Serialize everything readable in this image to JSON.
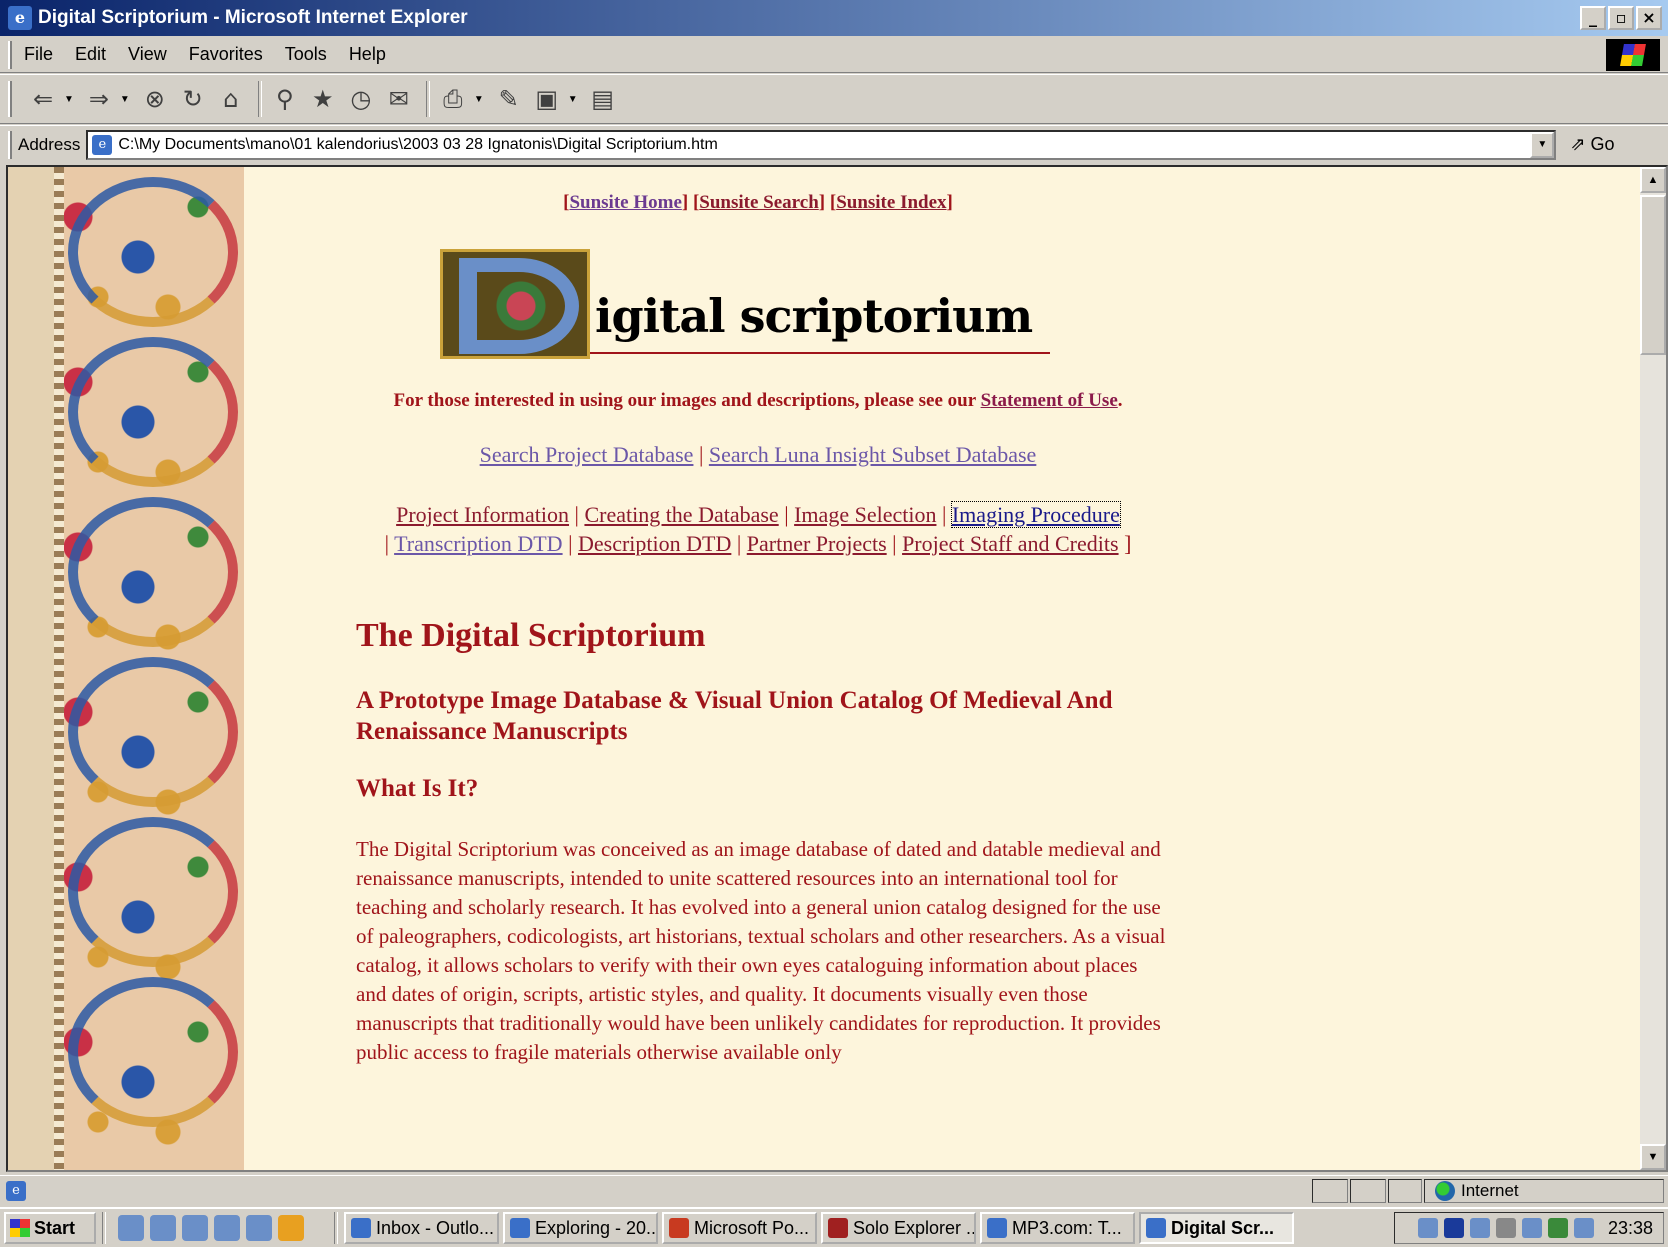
{
  "window": {
    "title": "Digital Scriptorium - Microsoft Internet Explorer"
  },
  "menu": [
    "File",
    "Edit",
    "View",
    "Favorites",
    "Tools",
    "Help"
  ],
  "toolbar": {
    "icons": [
      "back-icon",
      "forward-icon",
      "stop-icon",
      "refresh-icon",
      "home-icon",
      "search-icon",
      "favorites-icon",
      "history-icon",
      "mail-icon",
      "print-icon",
      "edit-icon",
      "discuss-icon"
    ]
  },
  "address": {
    "label": "Address",
    "value": "C:\\My Documents\\mano\\01 kalendorius\\2003 03 28 Ignatonis\\Digital Scriptorium.htm",
    "go": "Go"
  },
  "page": {
    "top_links": {
      "home": "Sunsite Home",
      "search": "Sunsite Search",
      "index": "Sunsite Index"
    },
    "logo_text": "igital scriptorium",
    "statement_prefix": "For those interested in using our images and descriptions, please see our ",
    "statement_link": "Statement of Use",
    "statement_suffix": ".",
    "search_links": [
      "Search Project Database",
      "Search Luna Insight Subset Database"
    ],
    "nav_links": [
      "Project Information",
      "Creating the Database",
      "Image Selection",
      "Imaging Procedure",
      "Transcription DTD",
      "Description DTD",
      "Partner Projects",
      "Project Staff and Credits"
    ],
    "nav_close": "]",
    "h1": "The Digital Scriptorium",
    "h2": "A Prototype Image Database & Visual Union Catalog Of Medieval And Renaissance Manuscripts",
    "h3": "What Is It?",
    "paragraph": "The Digital Scriptorium was conceived as an image database of dated and datable medieval and renaissance manuscripts, intended to unite scattered resources into an international tool for teaching and scholarly research. It has evolved into a general union catalog designed for the use of paleographers, codicologists, art historians, textual scholars and other researchers. As a visual catalog, it allows scholars to verify with their own eyes cataloguing information about places and dates of origin, scripts, artistic styles, and quality. It documents visually even those manuscripts that traditionally would have been unlikely candidates for reproduction. It provides public access to fragile materials otherwise available only"
  },
  "status": {
    "zone": "Internet"
  },
  "taskbar": {
    "start": "Start",
    "tasks": [
      "Inbox - Outlo...",
      "Exploring - 20...",
      "Microsoft Po...",
      "Solo Explorer ...",
      "MP3.com: T...",
      "Digital Scr..."
    ],
    "active_index": 5,
    "clock": "23:38"
  }
}
